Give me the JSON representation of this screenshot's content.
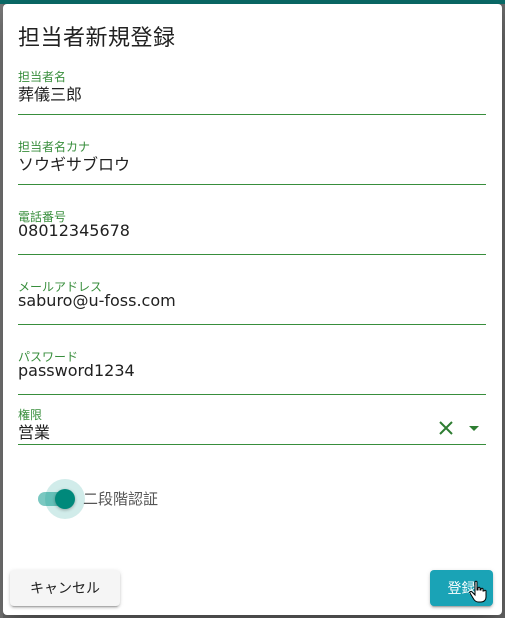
{
  "dialog": {
    "title": "担当者新規登録"
  },
  "fields": {
    "name": {
      "label": "担当者名",
      "value": "葬儀三郎"
    },
    "kana": {
      "label": "担当者名カナ",
      "value": "ソウギサブロウ"
    },
    "phone": {
      "label": "電話番号",
      "value": "08012345678"
    },
    "email": {
      "label": "メールアドレス",
      "value": "saburo@u-foss.com"
    },
    "password": {
      "label": "パスワード",
      "value": "password1234"
    },
    "role": {
      "label": "権限",
      "value": "営業"
    }
  },
  "two_factor": {
    "label": "二段階認証",
    "enabled": true
  },
  "actions": {
    "cancel_label": "キャンセル",
    "submit_label": "登録"
  },
  "colors": {
    "accent": "#388e3c",
    "primary_button": "#1aa3b6",
    "switch_on": "#00897b"
  },
  "icons": {
    "clear": "clear-x-icon",
    "dropdown": "dropdown-arrow-icon",
    "cursor": "hand-pointer-icon"
  }
}
